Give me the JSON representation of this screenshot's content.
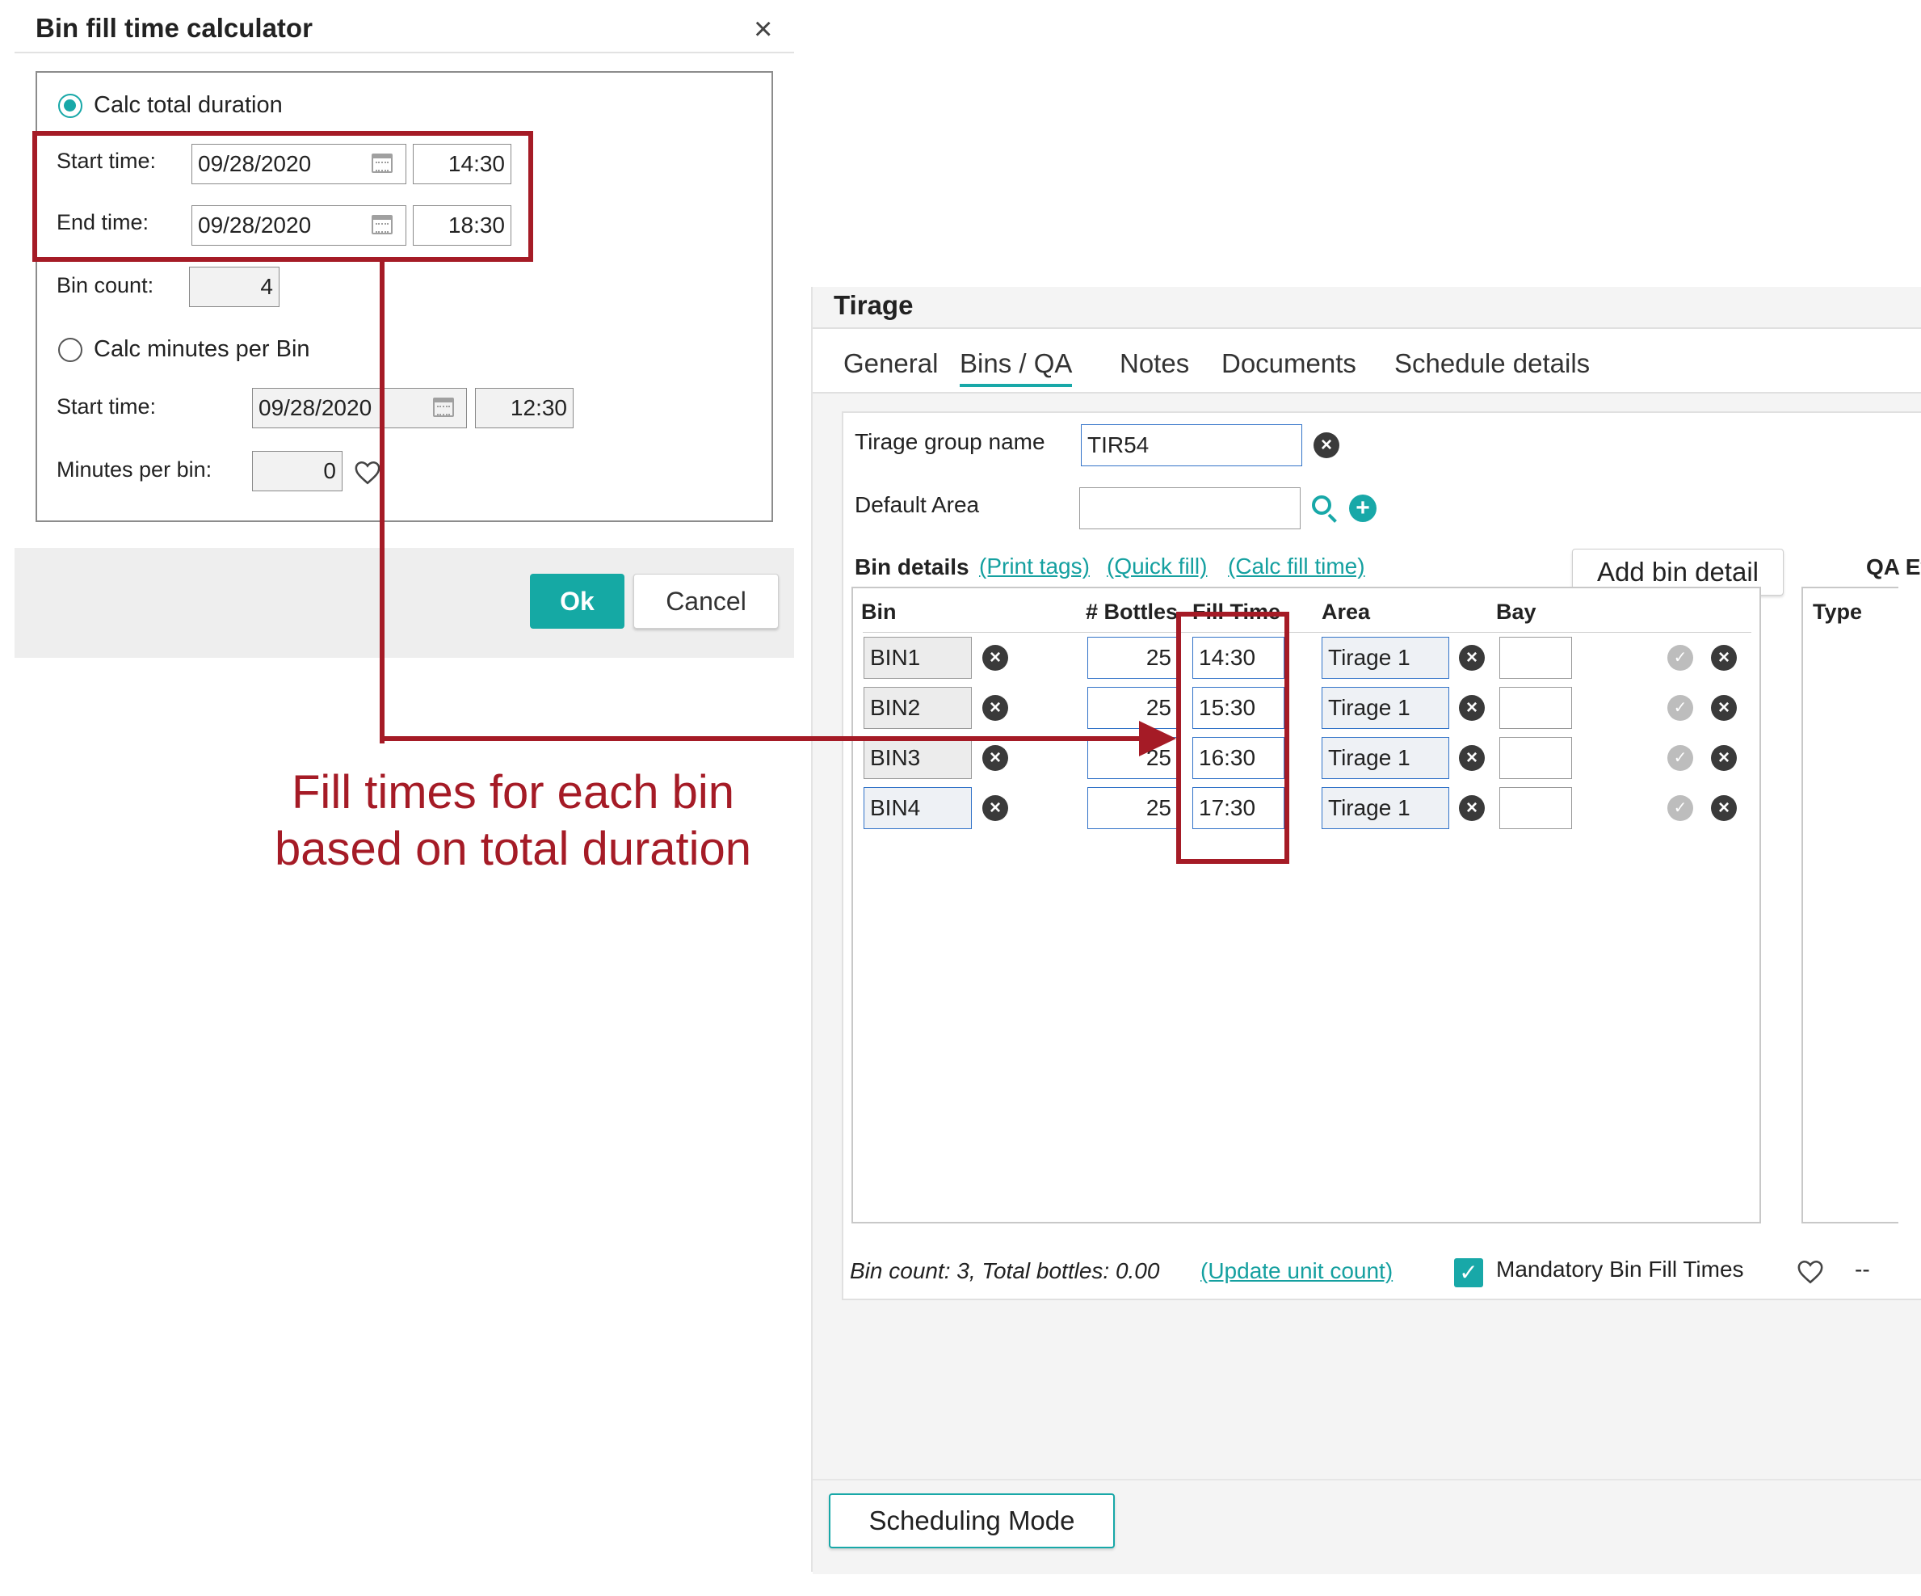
{
  "calculator": {
    "title": "Bin fill time calculator",
    "close_glyph": "×",
    "option_total": {
      "label": "Calc total duration",
      "selected": true,
      "start_label": "Start time:",
      "start_date": "09/28/2020",
      "start_time": "14:30",
      "end_label": "End time:",
      "end_date": "09/28/2020",
      "end_time": "18:30",
      "bin_count_label": "Bin count:",
      "bin_count": "4"
    },
    "option_minutes": {
      "label": "Calc minutes per Bin",
      "selected": false,
      "start_label": "Start time:",
      "start_date": "09/28/2020",
      "start_time": "12:30",
      "minutes_label": "Minutes per bin:",
      "minutes": "0"
    },
    "ok_label": "Ok",
    "cancel_label": "Cancel"
  },
  "annotation": {
    "line1": "Fill times for each bin",
    "line2": "based on total duration",
    "color": "#a51b26"
  },
  "tirage": {
    "title": "Tirage",
    "tabs": [
      "General",
      "Bins / QA",
      "Notes",
      "Documents",
      "Schedule details"
    ],
    "active_tab": "Bins / QA",
    "group_name_label": "Tirage group name",
    "group_name": "TIR54",
    "default_area_label": "Default Area",
    "default_area": "",
    "bin_details_label": "Bin details",
    "links": {
      "print_tags": "(Print tags)",
      "quick_fill": "(Quick fill)",
      "calc_fill_time": "(Calc fill time)"
    },
    "add_bin_label": "Add bin detail",
    "qa_label": "QA Ev",
    "qa_type_header": "Type",
    "columns": {
      "bin": "Bin",
      "bottles": "# Bottles",
      "fill_time": "Fill Time",
      "area": "Area",
      "bay": "Bay"
    },
    "rows": [
      {
        "bin": "BIN1",
        "bottles": "25",
        "fill_time": "14:30",
        "area": "Tirage 1",
        "bay": ""
      },
      {
        "bin": "BIN2",
        "bottles": "25",
        "fill_time": "15:30",
        "area": "Tirage 1",
        "bay": ""
      },
      {
        "bin": "BIN3",
        "bottles": "25",
        "fill_time": "16:30",
        "area": "Tirage 1",
        "bay": ""
      },
      {
        "bin": "BIN4",
        "bottles": "25",
        "fill_time": "17:30",
        "area": "Tirage 1",
        "bay": ""
      }
    ],
    "summary_text": "Bin count: 3, Total bottles: 0.00",
    "update_link": "(Update unit count)",
    "mandatory_label": "Mandatory Bin Fill Times",
    "mandatory_checked": true,
    "dash": "--",
    "scheduling_label": "Scheduling Mode"
  },
  "colors": {
    "accent": "#18a8a8",
    "annotation": "#a51b26",
    "ok_button": "#15a9a4"
  },
  "icons": [
    "close-icon",
    "calendar-icon",
    "heart-icon",
    "clear-icon",
    "search-icon",
    "add-icon",
    "check-icon",
    "checkbox-icon"
  ]
}
